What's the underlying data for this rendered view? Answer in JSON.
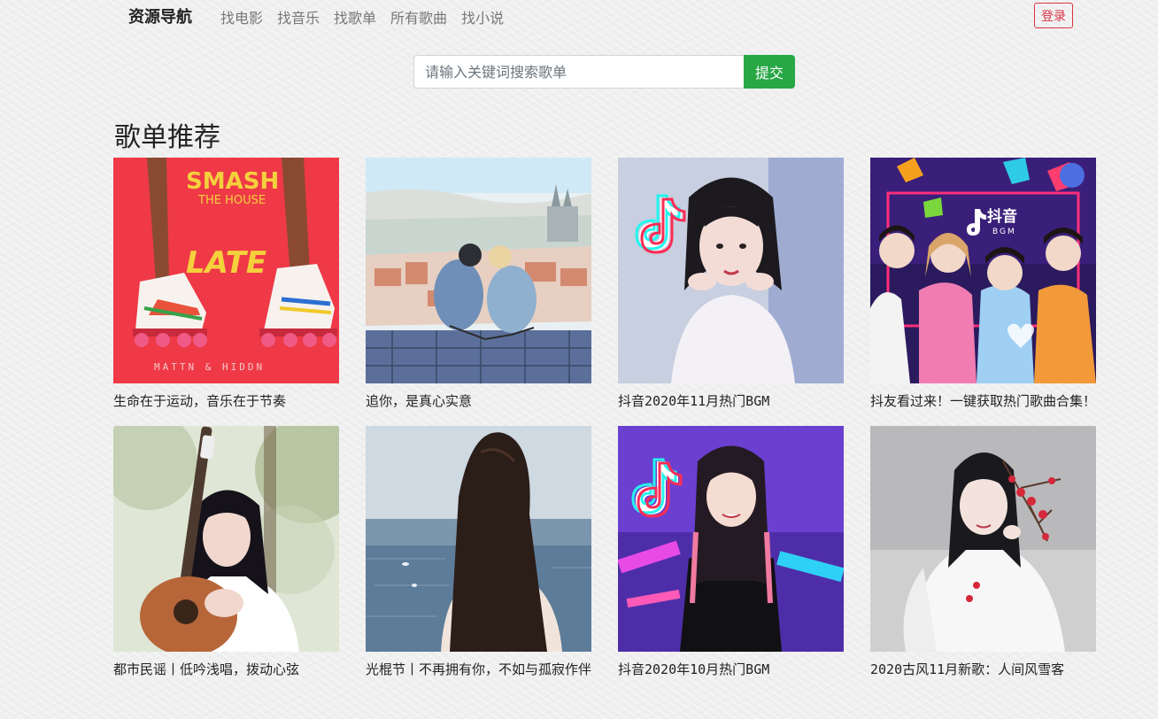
{
  "brand": "资源导航",
  "nav": {
    "links": [
      "找电影",
      "找音乐",
      "找歌单",
      "所有歌曲",
      "找小说"
    ],
    "login_label": "登录"
  },
  "search": {
    "placeholder": "请输入关键词搜索歌单",
    "value": "",
    "submit_label": "提交"
  },
  "section_title": "歌单推荐",
  "playlists": [
    {
      "title": "生命在于运动，音乐在于节奏",
      "cover": "roller-skates-cover",
      "cover_text": {
        "line1": "SMASH",
        "line2": "THE HOUSE",
        "line3": "LATE",
        "line4": "MATTN & HIDDN"
      }
    },
    {
      "title": "追你，是真心实意",
      "cover": "illustrated-couple-cover"
    },
    {
      "title": "抖音2020年11月热门BGM",
      "cover": "tiktok-portrait-cover"
    },
    {
      "title": "抖友看过来！一键获取热门歌曲合集！",
      "cover": "tiktok-group-cover",
      "cover_text": {
        "line1": "抖音",
        "line2": "BGM"
      }
    },
    {
      "title": "都市民谣丨低吟浅唱，拨动心弦",
      "cover": "guitar-girl-cover"
    },
    {
      "title": "光棍节丨不再拥有你，不如与孤寂作伴",
      "cover": "sea-back-cover"
    },
    {
      "title": "抖音2020年10月热门BGM",
      "cover": "tiktok-stage-cover"
    },
    {
      "title": "2020古风11月新歌：人间风雪客",
      "cover": "ancient-style-cover"
    }
  ],
  "colors": {
    "accent_green": "#28a745",
    "login_red": "#dc3545",
    "nav_text": "#777777"
  }
}
